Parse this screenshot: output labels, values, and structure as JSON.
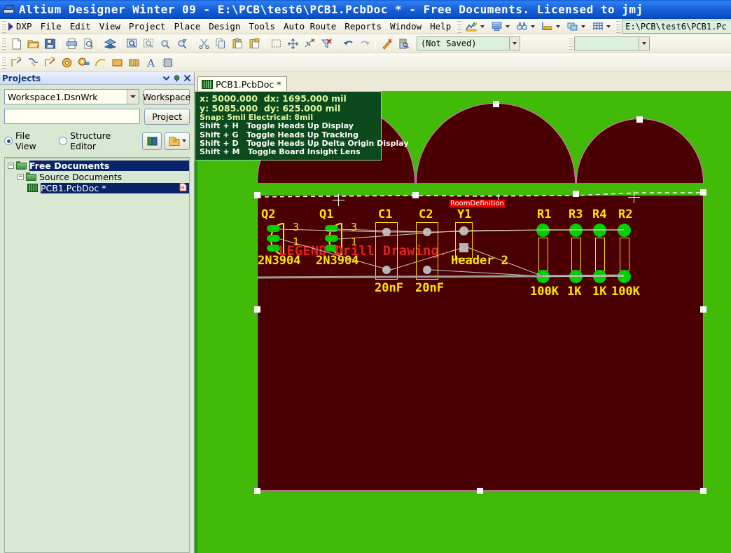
{
  "window": {
    "title": "Altium Designer Winter 09 - E:\\PCB\\test6\\PCB1.PcbDoc * - Free Documents. Licensed to jmj",
    "app_icon": "altium-icon"
  },
  "menu": {
    "dxp": "DXP",
    "items": [
      "File",
      "Edit",
      "View",
      "Project",
      "Place",
      "Design",
      "Tools",
      "Auto Route",
      "Reports",
      "Window",
      "Help"
    ],
    "right_dropdowns": [
      "chart-pencil-icon",
      "layers-stack-icon",
      "binoculars-icon",
      "ruler-icon",
      "cascade-icon",
      "grid-icon"
    ],
    "path_field": "E:\\PCB\\test6\\PCB1.Pc"
  },
  "toolbar1": {
    "icons": [
      "new-document-icon",
      "open-folder-icon",
      "save-icon",
      "print-icon",
      "print-preview-icon",
      "layer-stack-icon",
      "zoom-area-icon",
      "zoom-selection-icon",
      "zoom-out-icon",
      "zoom-filter-icon",
      "cut-icon",
      "copy-icon",
      "paste-icon",
      "paste-special-icon",
      "select-area-icon",
      "move-icon",
      "deselect-icon",
      "clear-filter-icon",
      "undo-icon",
      "redo-icon",
      "wand-icon",
      "browse-icon"
    ],
    "saved_state": "(Not Saved)"
  },
  "toolbar2": {
    "icons": [
      "place-track-icon",
      "place-interactive-route-icon",
      "place-line-icon",
      "place-pad-icon",
      "place-via-icon",
      "place-arc-icon",
      "place-fill-icon",
      "place-polygon-icon",
      "place-string-icon",
      "place-component-icon"
    ]
  },
  "panel": {
    "title": "Projects",
    "title_icons": [
      "chevron-down-icon",
      "pin-icon",
      "close-icon"
    ],
    "workspace_value": "Workspace1.DsnWrk",
    "workspace_button": "Workspace",
    "project_value": "",
    "project_button": "Project",
    "view_modes": [
      {
        "label": "File View",
        "selected": true
      },
      {
        "label": "Structure Editor",
        "selected": false
      }
    ],
    "action_icons": [
      "books-icon",
      "open-document-icon",
      "dropdown-arrow-icon"
    ],
    "tree": [
      {
        "label": "Free Documents",
        "icon": "folder-icon",
        "expander": "-",
        "indent": 0,
        "selected": true
      },
      {
        "label": "Source Documents",
        "icon": "folder-icon",
        "expander": "-",
        "indent": 1,
        "selected": false
      },
      {
        "label": "PCB1.PcbDoc *",
        "icon": "pcb-document-icon",
        "expander": "",
        "indent": 2,
        "selected": true,
        "right_icon": "document-page-icon"
      }
    ]
  },
  "editor": {
    "tab": {
      "label": "PCB1.PcbDoc *",
      "icon": "pcb-document-icon"
    }
  },
  "hud": {
    "x_label": "x:",
    "x_value": "5000.000",
    "dx_label": "dx:",
    "dx_value": "1695.000",
    "dx_unit": "mil",
    "y_label": "y:",
    "y_value": "5085.000",
    "dy_label": "dy:",
    "dy_value": "625.000",
    "dy_unit": "mil",
    "snap": "Snap: 5mil Electrical: 8mil",
    "shortcuts": [
      {
        "key": "Shift + H",
        "action": "Toggle Heads Up Display"
      },
      {
        "key": "Shift + G",
        "action": "Toggle Heads Up Tracking"
      },
      {
        "key": "Shift + D",
        "action": "Toggle Heads Up Delta Origin Display"
      },
      {
        "key": "Shift + M",
        "action": "Toggle Board Insight Lens"
      }
    ]
  },
  "pcb": {
    "board_outline_color": "#ff66dd",
    "board_fill_color": "#4a0000",
    "canvas_color": "#41ba08",
    "silkscreen_color": "#ffe400",
    "pad_color": "#00d000",
    "overlay_text": "LEGEND Drill Drawing.",
    "room_badge": "RoomDefinition",
    "components": [
      {
        "designator": "Q2",
        "value": "2N3904",
        "pins": [
          "3",
          "1"
        ],
        "type": "transistor"
      },
      {
        "designator": "Q1",
        "value": "2N3904",
        "pins": [
          "3",
          "1"
        ],
        "type": "transistor"
      },
      {
        "designator": "C1",
        "value": "20nF",
        "type": "capacitor"
      },
      {
        "designator": "C2",
        "value": "20nF",
        "type": "capacitor"
      },
      {
        "designator": "Y1",
        "value": "Header 2",
        "type": "header"
      },
      {
        "designator": "R1",
        "value": "100K",
        "type": "resistor"
      },
      {
        "designator": "R3",
        "value": "1K",
        "type": "resistor"
      },
      {
        "designator": "R4",
        "value": "1K",
        "type": "resistor"
      },
      {
        "designator": "R2",
        "value": "100K",
        "type": "resistor"
      }
    ]
  }
}
